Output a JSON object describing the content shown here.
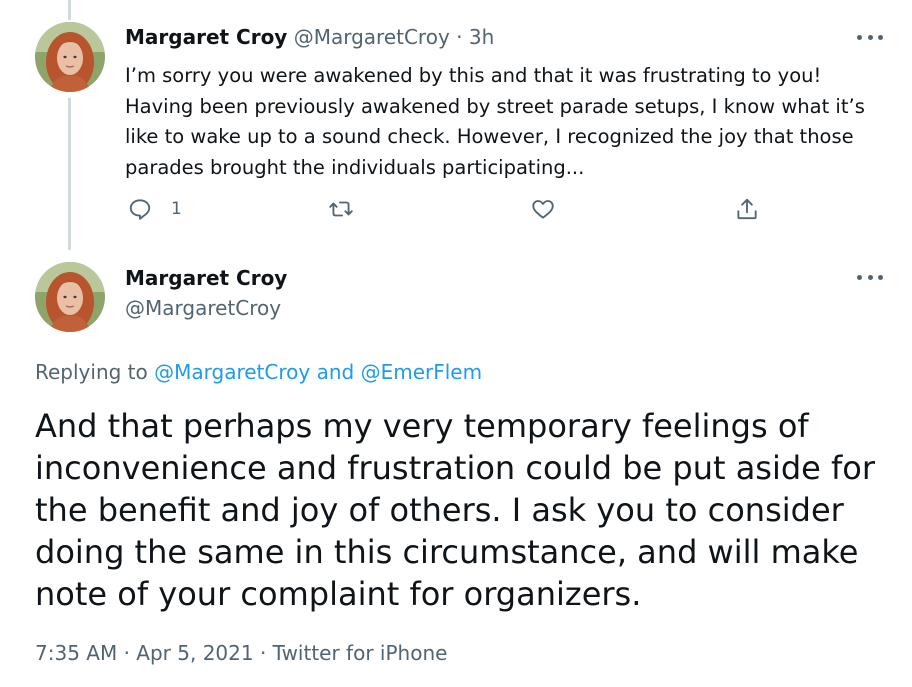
{
  "tweet1": {
    "name": "Margaret Croy",
    "handle": "@MargaretCroy",
    "separator": "·",
    "time": "3h",
    "text_lines": [
      "I’m sorry you were awakened by this and that it was frustrating to you!",
      "Having been previously awakened by street parade setups, I know what it’s",
      "like to wake up to a sound check. However, I recognized the joy that those",
      "parades brought the individuals participating..."
    ],
    "reply_count": "1",
    "icons": {
      "reply": "reply-icon",
      "retweet": "retweet-icon",
      "like": "heart-icon",
      "share": "share-icon",
      "more": "more-icon"
    }
  },
  "tweet2": {
    "name": "Margaret Croy",
    "handle": "@MargaretCroy",
    "replying_prefix": "Replying to",
    "replying_user1": "@MargaretCroy",
    "replying_and": "and",
    "replying_user2": "@EmerFlem",
    "text_lines": [
      "And that perhaps my very temporary feelings of",
      "inconvenience and frustration could be put aside for",
      "the benefit and joy of others. I ask you to consider",
      "doing the same in this circumstance, and will make",
      "note of your complaint for organizers."
    ],
    "time": "7:35 AM",
    "separator": "·",
    "date": "Apr 5, 2021",
    "separator2": "·",
    "source": "Twitter for iPhone"
  },
  "colors": {
    "text": "#0f1419",
    "muted": "#536471",
    "link": "#1d9bf0",
    "thread_line": "#cfd9de"
  }
}
